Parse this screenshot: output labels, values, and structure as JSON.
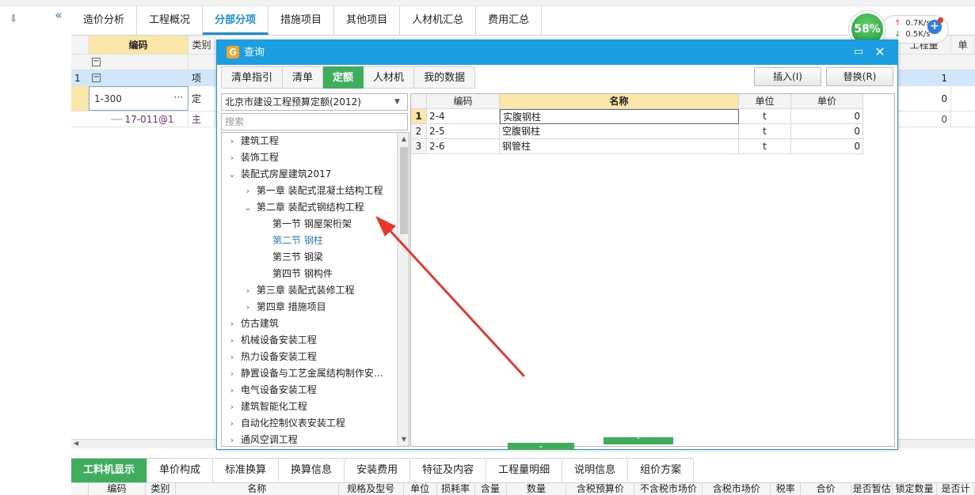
{
  "main_tabs": [
    {
      "label": "造价分析"
    },
    {
      "label": "工程概况"
    },
    {
      "label": "分部分项",
      "active": true
    },
    {
      "label": "措施项目"
    },
    {
      "label": "其他项目"
    },
    {
      "label": "人材机汇总"
    },
    {
      "label": "费用汇总"
    }
  ],
  "grid": {
    "headers": {
      "code": "编码",
      "type": "类别",
      "qty": "工程量",
      "edge": "单"
    },
    "rows": [
      {
        "num": "1",
        "type": "项",
        "qty": "1"
      },
      {
        "code": "1-300",
        "type": "定",
        "qty": "0"
      },
      {
        "code": "17-011@1",
        "type": "主",
        "qty": "0"
      }
    ]
  },
  "network": {
    "percent": "58%",
    "up": "0.7K/s",
    "down": "0.5K/s"
  },
  "dialog": {
    "title": "查询",
    "tabs": [
      {
        "label": "清单指引"
      },
      {
        "label": "清单"
      },
      {
        "label": "定额",
        "active": true
      },
      {
        "label": "人材机"
      },
      {
        "label": "我的数据"
      }
    ],
    "insert_label": "插入(I)",
    "replace_label": "替换(R)",
    "library": "北京市建设工程预算定额(2012)",
    "search_placeholder": "搜索",
    "tree": [
      {
        "label": "建筑工程",
        "level": 0,
        "expander": "›"
      },
      {
        "label": "装饰工程",
        "level": 0,
        "expander": "›"
      },
      {
        "label": "装配式房屋建筑2017",
        "level": 0,
        "expander": "⌄"
      },
      {
        "label": "第一章 装配式混凝土结构工程",
        "level": 1,
        "expander": "›"
      },
      {
        "label": "第二章 装配式钢结构工程",
        "level": 1,
        "expander": "⌄"
      },
      {
        "label": "第一节 钢屋架桁架",
        "level": 2,
        "expander": ""
      },
      {
        "label": "第二节 钢柱",
        "level": 2,
        "expander": "",
        "selected": true
      },
      {
        "label": "第三节 钢梁",
        "level": 2,
        "expander": ""
      },
      {
        "label": "第四节 钢构件",
        "level": 2,
        "expander": ""
      },
      {
        "label": "第三章 装配式装修工程",
        "level": 1,
        "expander": "›"
      },
      {
        "label": "第四章 措施项目",
        "level": 1,
        "expander": "›"
      },
      {
        "label": "仿古建筑",
        "level": 0,
        "expander": "›"
      },
      {
        "label": "机械设备安装工程",
        "level": 0,
        "expander": "›"
      },
      {
        "label": "热力设备安装工程",
        "level": 0,
        "expander": "›"
      },
      {
        "label": "静置设备与工艺金属结构制作安…",
        "level": 0,
        "expander": "›"
      },
      {
        "label": "电气设备安装工程",
        "level": 0,
        "expander": "›"
      },
      {
        "label": "建筑智能化工程",
        "level": 0,
        "expander": "›"
      },
      {
        "label": "自动化控制仪表安装工程",
        "level": 0,
        "expander": "›"
      },
      {
        "label": "通风空调工程",
        "level": 0,
        "expander": "›"
      }
    ],
    "result_headers": {
      "code": "编码",
      "name": "名称",
      "unit": "单位",
      "price": "单价"
    },
    "results": [
      {
        "num": "1",
        "code": "2-4",
        "name": "实腹钢柱",
        "unit": "t",
        "price": "0"
      },
      {
        "num": "2",
        "code": "2-5",
        "name": "空腹钢柱",
        "unit": "t",
        "price": "0"
      },
      {
        "num": "3",
        "code": "2-6",
        "name": "钢管柱",
        "unit": "t",
        "price": "0"
      }
    ]
  },
  "bottom_tabs": [
    {
      "label": "工料机显示",
      "active": true
    },
    {
      "label": "单价构成"
    },
    {
      "label": "标准换算"
    },
    {
      "label": "换算信息"
    },
    {
      "label": "安装费用"
    },
    {
      "label": "特征及内容"
    },
    {
      "label": "工程量明细"
    },
    {
      "label": "说明信息"
    },
    {
      "label": "组价方案"
    }
  ],
  "bottom_headers": [
    "编码",
    "类别",
    "名称",
    "规格及型号",
    "单位",
    "损耗率",
    "含量",
    "数量",
    "含税预算价",
    "不含税市场价",
    "含税市场价",
    "税率",
    "合价",
    "是否暂估",
    "锁定数量",
    "是否计"
  ],
  "colors": {
    "accent_blue": "#1c9ee3",
    "accent_green": "#3fae5c",
    "annotation_red": "#e8382a"
  }
}
